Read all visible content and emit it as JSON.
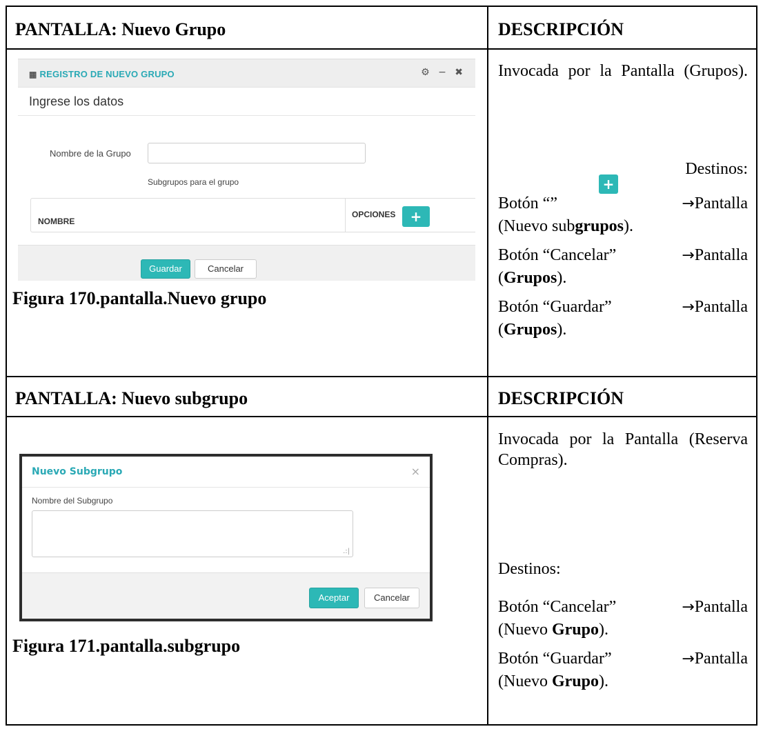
{
  "section1": {
    "header_left": "PANTALLA: Nuevo Grupo",
    "header_right": "DESCRIPCIÓN",
    "screenshot": {
      "window_title": "REGISTRO DE NUEVO GRUPO",
      "tools": "⚙ − ✖",
      "subtitle": "Ingrese los datos",
      "field_label": "Nombre de la Grupo",
      "field_value": "",
      "subgroups_hint": "Subgrupos para el grupo",
      "col_nombre": "NOMBRE",
      "col_opciones": "OPCIONES",
      "add_symbol": "+",
      "save_label": "Guardar",
      "cancel_label": "Cancelar"
    },
    "caption": "Figura 170.pantalla.Nuevo grupo",
    "desc": {
      "invoked": "Invocada por la Pantalla (Grupos).",
      "destinos": "Destinos:",
      "l1_pre": "Botón “”",
      "l1_arrow": "→",
      "l1_post": "Pantalla",
      "l1_cont_a": "(Nuevo sub",
      "l1_cont_b": "grupos",
      "l1_cont_c": ").",
      "l2_pre": "Botón “Cancelar”",
      "l2_post": "Pantalla",
      "l2_cont_a": "(",
      "l2_cont_b": "Grupos",
      "l2_cont_c": ").",
      "l3_pre": "Botón “Guardar”",
      "l3_post": "Pantalla",
      "l3_cont_a": "(",
      "l3_cont_b": "Grupos",
      "l3_cont_c": ")."
    }
  },
  "section2": {
    "header_left": "PANTALLA: Nuevo subgrupo",
    "header_right": "DESCRIPCIÓN",
    "screenshot": {
      "modal_title": "Nuevo Subgrupo",
      "close_symbol": "×",
      "field_label": "Nombre del Subgrupo",
      "field_value": "",
      "resize_grip": ".:|",
      "accept_label": "Aceptar",
      "cancel_label": "Cancelar"
    },
    "caption": "Figura 171.pantalla.subgrupo",
    "desc": {
      "invoked": "Invocada por la Pantalla (Reserva Compras).",
      "destinos": "Destinos:",
      "l1_pre": "Botón “Cancelar”",
      "l1_post": "Pantalla",
      "l1_cont_a": "(Nuevo ",
      "l1_cont_b": "Grupo",
      "l1_cont_c": ").",
      "l2_pre": "Botón “Guardar”",
      "l2_post": "Pantalla",
      "l2_cont_a": "(Nuevo ",
      "l2_cont_b": "Grupo",
      "l2_cont_c": ")."
    }
  }
}
